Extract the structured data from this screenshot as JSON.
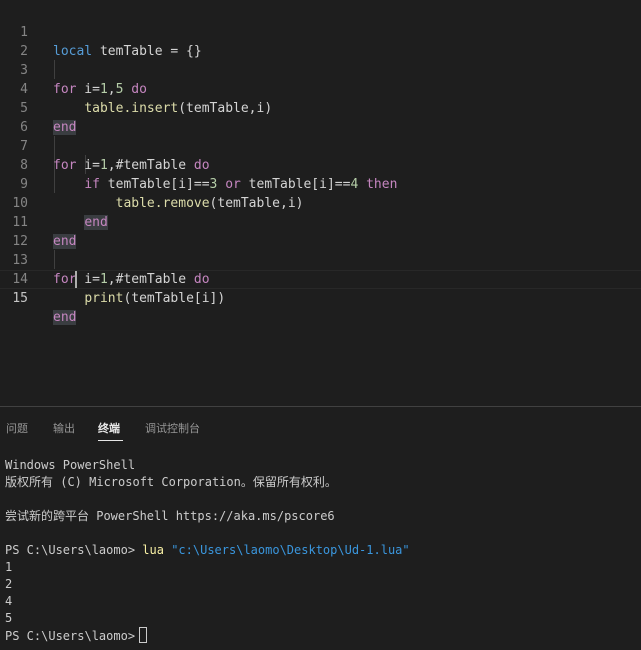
{
  "editor": {
    "line_numbers": [
      "1",
      "2",
      "3",
      "4",
      "5",
      "6",
      "7",
      "8",
      "9",
      "10",
      "11",
      "12",
      "13",
      "14",
      "15"
    ],
    "current_line": "15",
    "lines": {
      "l1": {
        "kw_local": "local",
        "text": " temTable = {}"
      },
      "l3": {
        "kw_for": "for",
        "var": " i=",
        "n1": "1",
        "comma": ",",
        "n2": "5",
        "kw_do": "do"
      },
      "l4": {
        "fn": "table.insert",
        "args": "(temTable,i)"
      },
      "l5": {
        "kw_end": "end"
      },
      "l7": {
        "kw_for": "for",
        "var": " i=",
        "n1": "1",
        "rest": ",#temTable ",
        "kw_do": "do"
      },
      "l8": {
        "kw_if": "if",
        "a": " temTable[i]==",
        "n1": "3",
        "kw_or": "or",
        "b": " temTable[i]==",
        "n2": "4",
        "kw_then": "then"
      },
      "l9": {
        "fn": "table.remove",
        "args": "(temTable,i)"
      },
      "l10": {
        "kw_end": "end"
      },
      "l11": {
        "kw_end": "end"
      },
      "l13": {
        "kw_for": "for",
        "var": " i=",
        "n1": "1",
        "rest": ",#temTable ",
        "kw_do": "do"
      },
      "l14": {
        "fn": "print",
        "args": "(temTable[i])"
      },
      "l15": {
        "kw_end": "end"
      }
    }
  },
  "panel": {
    "tabs": [
      {
        "label": "问题"
      },
      {
        "label": "输出"
      },
      {
        "label": "终端"
      },
      {
        "label": "调试控制台"
      }
    ],
    "active_tab": "终端",
    "terminal": {
      "l1": "Windows PowerShell",
      "l2": "版权所有 (C) Microsoft Corporation。保留所有权利。",
      "l3": "尝试新的跨平台 PowerShell https://aka.ms/pscore6",
      "prompt1": "PS C:\\Users\\laomo> ",
      "cmd": "lua",
      "arg": "\"c:\\Users\\laomo\\Desktop\\Ud-1.lua\"",
      "out": [
        "1",
        "2",
        "4",
        "5"
      ],
      "prompt2": "PS C:\\Users\\laomo>"
    }
  },
  "colors": {
    "background": "#1e1e1e",
    "keyword": "#c586c0",
    "local_keyword": "#569cd6",
    "number": "#b5cea8",
    "function": "#dcdcaa",
    "terminal_command": "#f9f1a5",
    "terminal_string": "#3a96dd"
  }
}
